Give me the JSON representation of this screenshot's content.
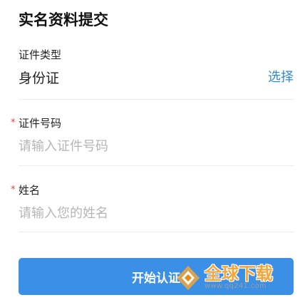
{
  "page": {
    "title": "实名资料提交"
  },
  "id_type": {
    "label": "证件类型",
    "value": "身份证",
    "select_label": "选择"
  },
  "id_number": {
    "required_mark": "*",
    "label": "证件号码",
    "placeholder": "请输入证件号码"
  },
  "name": {
    "required_mark": "*",
    "label": "姓名",
    "placeholder": "请输入您的姓名"
  },
  "submit": {
    "label": "开始认证"
  },
  "watermark": {
    "text": "全球下载",
    "url": "www.qq241.com"
  },
  "colors": {
    "accent": "#3b8fe5",
    "link": "#2f88d8",
    "required": "#e64340",
    "placeholder": "#b5b5b5",
    "watermark": "#f3a63b"
  }
}
